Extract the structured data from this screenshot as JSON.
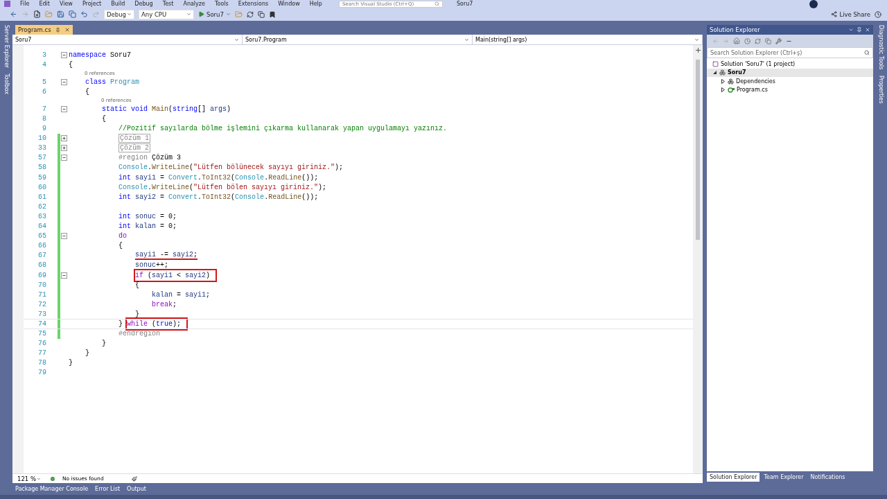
{
  "menu": [
    "File",
    "Edit",
    "View",
    "Project",
    "Build",
    "Debug",
    "Test",
    "Analyze",
    "Tools",
    "Extensions",
    "Window",
    "Help"
  ],
  "search_box": {
    "placeholder": "Search Visual Studio (Ctrl+Q)"
  },
  "solution_name": "Soru7",
  "toolbar": {
    "configuration": "Debug",
    "platform": "Any CPU",
    "start_target": "Soru7"
  },
  "live_share": "Live Share",
  "left_tool_tabs": [
    "Server Explorer",
    "Toolbox"
  ],
  "document_tabs": [
    {
      "label": "Program.cs",
      "selected": true
    }
  ],
  "nav_bar": {
    "project": "Soru7",
    "type": "Soru7.Program",
    "member": "Main(string[] args)"
  },
  "code_lines": [
    {
      "number": "3",
      "folded": false,
      "tokens": [
        {
          "kind": "kw",
          "text": "namespace"
        },
        {
          "kind": "plain",
          "text": " Soru7"
        }
      ]
    },
    {
      "number": "4",
      "tokens": [
        {
          "kind": "plain",
          "text": "{"
        }
      ],
      "children": [
        {
          "number": "5",
          "codelens": "0 references",
          "folded": false,
          "tokens": [
            {
              "kind": "kw",
              "text": "class"
            },
            {
              "kind": "type",
              "text": " Program"
            }
          ]
        },
        {
          "number": "6",
          "tokens": [
            {
              "kind": "plain",
              "text": "{"
            }
          ],
          "children": [
            {
              "number": "7",
              "codelens": "0 references",
              "folded": false,
              "tokens": [
                {
                  "kind": "kw",
                  "text": "static void"
                },
                {
                  "kind": "method",
                  "text": " Main"
                },
                {
                  "kind": "plain",
                  "text": "("
                },
                {
                  "kind": "kw",
                  "text": "string"
                },
                {
                  "kind": "plain",
                  "text": "[] "
                },
                {
                  "kind": "local",
                  "text": "args"
                },
                {
                  "kind": "plain",
                  "text": ")"
                }
              ]
            },
            {
              "number": "8",
              "tokens": [
                {
                  "kind": "plain",
                  "text": "{"
                }
              ],
              "children": [
                {
                  "number": "9",
                  "tokens": [
                    {
                      "kind": "comment",
                      "text": "//Pozitif sayılarda bölme işlemini çıkarma kullanarak yapan uygulamayı yazınız."
                    }
                  ]
                },
                {
                  "number": "10",
                  "folded": true,
                  "changed": true,
                  "collapsed": "Çözüm 1"
                },
                {
                  "number": "33",
                  "folded": true,
                  "changed": true,
                  "collapsed": "Çözüm 2"
                },
                {
                  "number": "57",
                  "folded": false,
                  "changed": true,
                  "tokens": [
                    {
                      "kind": "preproc",
                      "text": "#region"
                    },
                    {
                      "kind": "plain",
                      "text": " Çözüm 3"
                    }
                  ]
                },
                {
                  "number": "58",
                  "changed": true,
                  "tokens": [
                    {
                      "kind": "type",
                      "text": "Console"
                    },
                    {
                      "kind": "plain",
                      "text": "."
                    },
                    {
                      "kind": "method",
                      "text": "WriteLine"
                    },
                    {
                      "kind": "plain",
                      "text": "("
                    },
                    {
                      "kind": "string",
                      "text": "\"Lütfen bölünecek sayıyı giriniz.\""
                    },
                    {
                      "kind": "plain",
                      "text": ");"
                    }
                  ]
                },
                {
                  "number": "59",
                  "changed": true,
                  "tokens": [
                    {
                      "kind": "kw",
                      "text": "int"
                    },
                    {
                      "kind": "local",
                      "text": " sayi1"
                    },
                    {
                      "kind": "plain",
                      "text": " = "
                    },
                    {
                      "kind": "type",
                      "text": "Convert"
                    },
                    {
                      "kind": "plain",
                      "text": "."
                    },
                    {
                      "kind": "method",
                      "text": "ToInt32"
                    },
                    {
                      "kind": "plain",
                      "text": "("
                    },
                    {
                      "kind": "type",
                      "text": "Console"
                    },
                    {
                      "kind": "plain",
                      "text": "."
                    },
                    {
                      "kind": "method",
                      "text": "ReadLine"
                    },
                    {
                      "kind": "plain",
                      "text": "());"
                    }
                  ]
                },
                {
                  "number": "60",
                  "changed": true,
                  "tokens": [
                    {
                      "kind": "type",
                      "text": "Console"
                    },
                    {
                      "kind": "plain",
                      "text": "."
                    },
                    {
                      "kind": "method",
                      "text": "WriteLine"
                    },
                    {
                      "kind": "plain",
                      "text": "("
                    },
                    {
                      "kind": "string",
                      "text": "\"Lütfen bölen sayıyı giriniz.\""
                    },
                    {
                      "kind": "plain",
                      "text": ");"
                    }
                  ]
                },
                {
                  "number": "61",
                  "changed": true,
                  "tokens": [
                    {
                      "kind": "kw",
                      "text": "int"
                    },
                    {
                      "kind": "local",
                      "text": " sayi2"
                    },
                    {
                      "kind": "plain",
                      "text": " = "
                    },
                    {
                      "kind": "type",
                      "text": "Convert"
                    },
                    {
                      "kind": "plain",
                      "text": "."
                    },
                    {
                      "kind": "method",
                      "text": "ToInt32"
                    },
                    {
                      "kind": "plain",
                      "text": "("
                    },
                    {
                      "kind": "type",
                      "text": "Console"
                    },
                    {
                      "kind": "plain",
                      "text": "."
                    },
                    {
                      "kind": "method",
                      "text": "ReadLine"
                    },
                    {
                      "kind": "plain",
                      "text": "());"
                    }
                  ]
                },
                {
                  "number": "62",
                  "changed": true
                },
                {
                  "number": "63",
                  "changed": true,
                  "tokens": [
                    {
                      "kind": "kw",
                      "text": "int"
                    },
                    {
                      "kind": "local",
                      "text": " sonuc"
                    },
                    {
                      "kind": "plain",
                      "text": " = 0;"
                    }
                  ]
                },
                {
                  "number": "64",
                  "changed": true,
                  "tokens": [
                    {
                      "kind": "kw",
                      "text": "int"
                    },
                    {
                      "kind": "local",
                      "text": " kalan"
                    },
                    {
                      "kind": "plain",
                      "text": " = 0;"
                    }
                  ]
                },
                {
                  "number": "65",
                  "folded": false,
                  "changed": true,
                  "tokens": [
                    {
                      "kind": "control",
                      "text": "do"
                    }
                  ]
                },
                {
                  "number": "66",
                  "changed": true,
                  "tokens": [
                    {
                      "kind": "plain",
                      "text": "{"
                    }
                  ],
                  "children": [
                    {
                      "number": "67",
                      "changed": true,
                      "mark": {
                        "kind": "underline",
                        "tokens": [
                          {
                            "kind": "local",
                            "text": "sayi1"
                          },
                          {
                            "kind": "plain",
                            "text": " -= "
                          },
                          {
                            "kind": "local",
                            "text": "sayi2"
                          },
                          {
                            "kind": "plain",
                            "text": ";"
                          }
                        ]
                      }
                    },
                    {
                      "number": "68",
                      "changed": true,
                      "tokens": [
                        {
                          "kind": "local",
                          "text": "sonuc"
                        },
                        {
                          "kind": "plain",
                          "text": "++;"
                        }
                      ]
                    },
                    {
                      "number": "69",
                      "folded": false,
                      "changed": true,
                      "mark": {
                        "kind": "box",
                        "tokens": [
                          {
                            "kind": "control",
                            "text": "if"
                          },
                          {
                            "kind": "plain",
                            "text": " ("
                          },
                          {
                            "kind": "local",
                            "text": "sayi1"
                          },
                          {
                            "kind": "plain",
                            "text": " < "
                          },
                          {
                            "kind": "local",
                            "text": "sayi2"
                          },
                          {
                            "kind": "plain",
                            "text": ")"
                          }
                        ]
                      }
                    },
                    {
                      "number": "70",
                      "changed": true,
                      "tokens": [
                        {
                          "kind": "plain",
                          "text": "{"
                        }
                      ],
                      "children": [
                        {
                          "number": "71",
                          "changed": true,
                          "tokens": [
                            {
                              "kind": "local",
                              "text": "kalan"
                            },
                            {
                              "kind": "plain",
                              "text": " = "
                            },
                            {
                              "kind": "local",
                              "text": "sayi1"
                            },
                            {
                              "kind": "plain",
                              "text": ";"
                            }
                          ]
                        },
                        {
                          "number": "72",
                          "changed": true,
                          "tokens": [
                            {
                              "kind": "control",
                              "text": "break"
                            },
                            {
                              "kind": "plain",
                              "text": ";"
                            }
                          ]
                        }
                      ]
                    },
                    {
                      "number": "73",
                      "changed": true,
                      "tokens": [
                        {
                          "kind": "plain",
                          "text": "}"
                        }
                      ]
                    }
                  ]
                },
                {
                  "number": "74",
                  "changed": true,
                  "current": true,
                  "tokens": [
                    {
                      "kind": "plain",
                      "text": "}"
                    }
                  ],
                  "mark": {
                    "kind": "box",
                    "tokens": [
                      {
                        "kind": "control",
                        "text": "while"
                      },
                      {
                        "kind": "plain",
                        "text": " ("
                      },
                      {
                        "kind": "kw",
                        "text": "true"
                      },
                      {
                        "kind": "plain",
                        "text": ");"
                      }
                    ]
                  }
                },
                {
                  "number": "75",
                  "changed": true,
                  "tokens": [
                    {
                      "kind": "preproc",
                      "text": "#endregion"
                    }
                  ]
                }
              ]
            },
            {
              "number": "76",
              "tokens": [
                {
                  "kind": "plain",
                  "text": "}"
                }
              ]
            }
          ]
        },
        {
          "number": "77",
          "tokens": [
            {
              "kind": "plain",
              "text": "}"
            }
          ]
        }
      ]
    },
    {
      "number": "78",
      "tokens": [
        {
          "kind": "plain",
          "text": "}"
        }
      ]
    },
    {
      "number": "79"
    }
  ],
  "editor_status": {
    "zoom": "121 %",
    "issues": "No issues found"
  },
  "solution_explorer": {
    "title": "Solution Explorer",
    "search": {
      "placeholder": "Search Solution Explorer (Ctrl+ş)"
    },
    "tree": [
      {
        "label": "Solution 'Soru7' (1 project)",
        "kind": "solution",
        "children": [
          {
            "label": "Soru7",
            "kind": "project",
            "expanded": true,
            "children": [
              {
                "label": "Dependencies",
                "kind": "dependencies",
                "expanded": false
              },
              {
                "label": "Program.cs",
                "kind": "csfile",
                "expanded": false
              }
            ]
          }
        ]
      }
    ]
  },
  "panel_tabs": [
    {
      "label": "Solution Explorer",
      "selected": true
    },
    {
      "label": "Team Explorer",
      "selected": false
    },
    {
      "label": "Notifications",
      "selected": false
    }
  ],
  "right_tool_tabs": [
    "Diagnostic Tools",
    "Properties"
  ],
  "bottom_tabs": [
    "Package Manager Console",
    "Error List",
    "Output"
  ]
}
